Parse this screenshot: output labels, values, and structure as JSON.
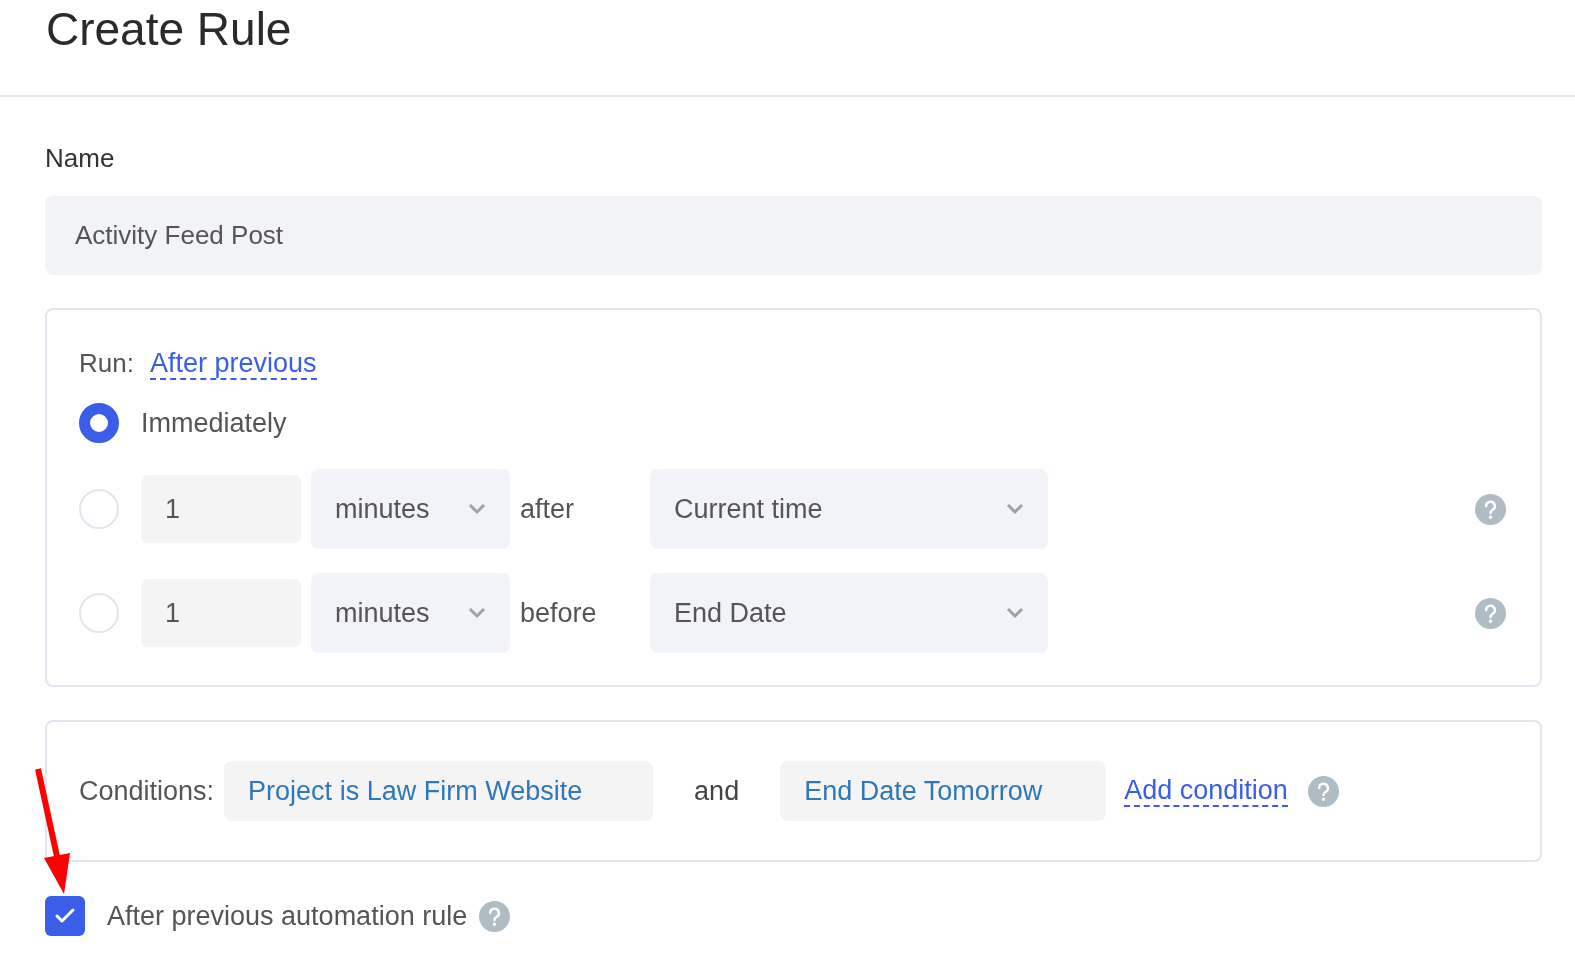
{
  "title": "Create Rule",
  "name_field": {
    "label": "Name",
    "value": "Activity Feed Post"
  },
  "run": {
    "label": "Run:",
    "mode_link": "After previous",
    "options": [
      {
        "kind": "immediate",
        "label": "Immediately",
        "selected": true
      },
      {
        "kind": "offset",
        "selected": false,
        "amount": "1",
        "unit": "minutes",
        "relation": "after",
        "reference": "Current time"
      },
      {
        "kind": "offset",
        "selected": false,
        "amount": "1",
        "unit": "minutes",
        "relation": "before",
        "reference": "End Date"
      }
    ]
  },
  "conditions": {
    "label": "Conditions:",
    "items": [
      "Project is Law Firm Website",
      "End Date Tomorrow"
    ],
    "joiner": "and",
    "add_link": "Add condition"
  },
  "after_previous": {
    "label": "After previous automation rule",
    "checked": true
  }
}
